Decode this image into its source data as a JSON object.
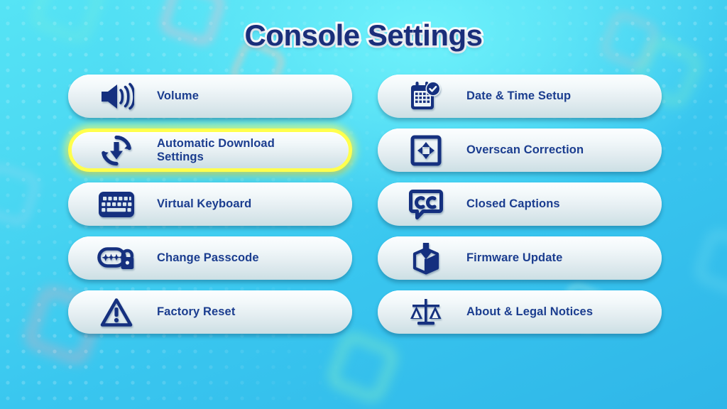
{
  "page": {
    "title": "Console Settings",
    "title_color": "#1a2e7a",
    "accent_highlight_color": "#ffff4d",
    "label_color": "#1b3d8f",
    "icon_color": "#15307f",
    "background_colors": [
      "#56e4f5",
      "#39c6ef",
      "#2fb6e8"
    ]
  },
  "menu": {
    "columns": 2,
    "items": [
      {
        "id": "volume",
        "label": "Volume",
        "icon": "speaker-volume-icon",
        "column": "left",
        "row": 1,
        "selected": false
      },
      {
        "id": "date-time",
        "label": "Date & Time Setup",
        "icon": "calendar-clock-icon",
        "column": "right",
        "row": 1,
        "selected": false
      },
      {
        "id": "auto-download",
        "label": "Automatic Download\nSettings",
        "icon": "auto-download-refresh-icon",
        "column": "left",
        "row": 2,
        "selected": true
      },
      {
        "id": "overscan",
        "label": "Overscan Correction",
        "icon": "overscan-arrows-icon",
        "column": "right",
        "row": 2,
        "selected": false
      },
      {
        "id": "virtual-keyboard",
        "label": "Virtual Keyboard",
        "icon": "keyboard-icon",
        "column": "left",
        "row": 3,
        "selected": false
      },
      {
        "id": "closed-captions",
        "label": "Closed Captions",
        "icon": "closed-captions-cc-icon",
        "column": "right",
        "row": 3,
        "selected": false
      },
      {
        "id": "change-passcode",
        "label": "Change Passcode",
        "icon": "passcode-lock-icon",
        "column": "left",
        "row": 4,
        "selected": false
      },
      {
        "id": "firmware-update",
        "label": "Firmware Update",
        "icon": "firmware-box-download-icon",
        "column": "right",
        "row": 4,
        "selected": false
      },
      {
        "id": "factory-reset",
        "label": "Factory Reset",
        "icon": "warning-triangle-icon",
        "column": "left",
        "row": 5,
        "selected": false
      },
      {
        "id": "about-legal",
        "label": "About & Legal Notices",
        "icon": "scales-justice-icon",
        "column": "right",
        "row": 5,
        "selected": false
      }
    ]
  }
}
